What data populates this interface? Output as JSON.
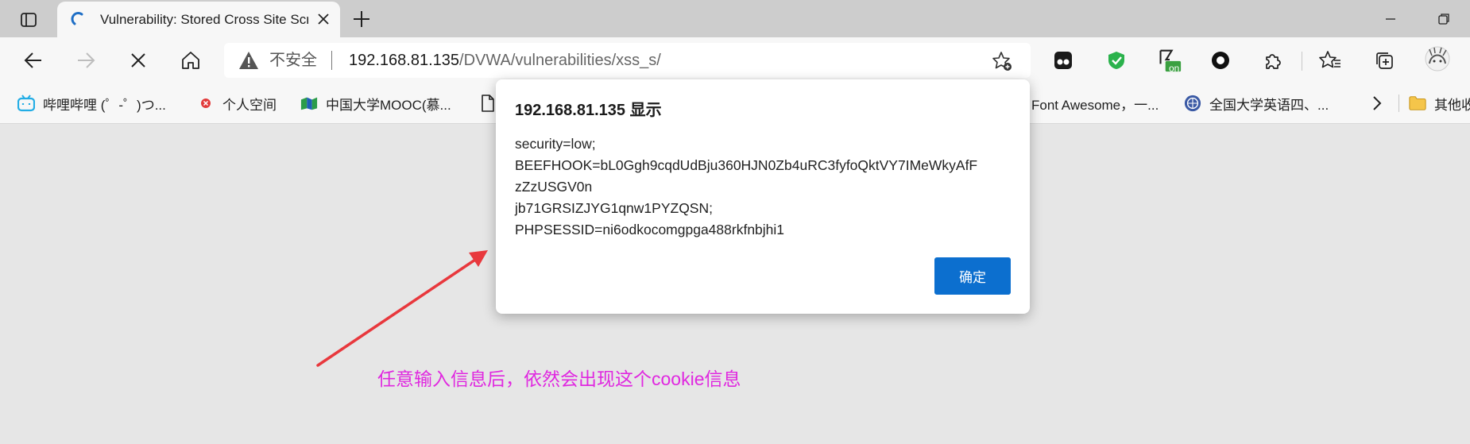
{
  "tab": {
    "title": "Vulnerability: Stored Cross Site Scripting (XSS)"
  },
  "address_bar": {
    "security_label": "不安全",
    "url_host": "192.168.81.135",
    "url_path": "/DVWA/vulnerabilities/xss_s/"
  },
  "extensions": {
    "badge_text": "on"
  },
  "bookmarks": {
    "items": [
      {
        "label": "哔哩哔哩 (゜-゜)つ..."
      },
      {
        "label": "个人空间"
      },
      {
        "label": "中国大学MOOC(慕..."
      },
      {
        "label": "Font Awesome，一..."
      },
      {
        "label": "全国大学英语四、..."
      },
      {
        "label": "其他收藏夹"
      }
    ]
  },
  "dialog": {
    "title": "192.168.81.135 显示",
    "lines": [
      "security=low;",
      "BEEFHOOK=bL0Ggh9cqdUdBju360HJN0Zb4uRC3fyfoQktVY7IMeWkyAfF",
      "zZzUSGV0n",
      "jb71GRSIZJYG1qnw1PYZQSN;",
      "PHPSESSID=ni6odkocomgpga488rkfnbjhi1"
    ],
    "ok_label": "确定"
  },
  "annotation": {
    "text": "任意输入信息后，依然会出现这个cookie信息",
    "color": "#e028e0",
    "arrow_color": "#e8383d"
  }
}
